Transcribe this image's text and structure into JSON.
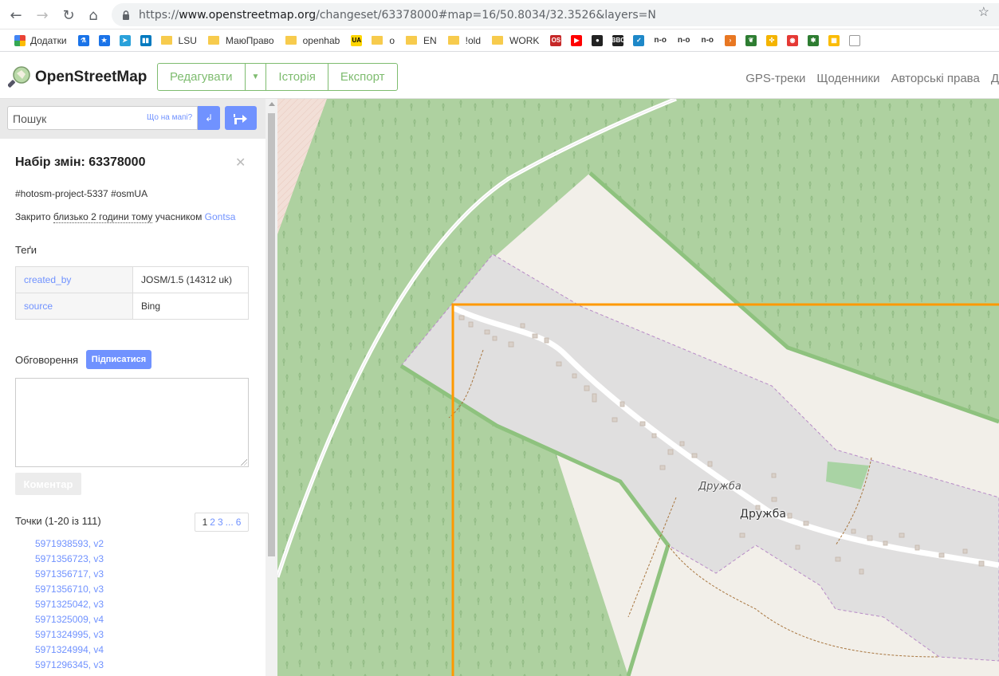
{
  "browser": {
    "url_scheme": "https://",
    "url_host": "www.openstreetmap.org",
    "url_path": "/changeset/63378000#map=16/50.8034/32.3526&layers=N",
    "bookmarks": [
      {
        "label": "Додатки",
        "kind": "apps"
      },
      {
        "label": "",
        "kind": "lab-icon"
      },
      {
        "label": "",
        "kind": "star-bookmark"
      },
      {
        "label": "",
        "kind": "telegram"
      },
      {
        "label": "",
        "kind": "trello"
      },
      {
        "label": "LSU",
        "kind": "folder"
      },
      {
        "label": "МаюПраво",
        "kind": "folder"
      },
      {
        "label": "openhab",
        "kind": "folder"
      },
      {
        "label": "UA",
        "kind": "ua"
      },
      {
        "label": "o",
        "kind": "folder"
      },
      {
        "label": "EN",
        "kind": "folder"
      },
      {
        "label": "!old",
        "kind": "folder"
      },
      {
        "label": "WORK",
        "kind": "folder"
      },
      {
        "label": "os",
        "kind": "os"
      },
      {
        "label": "",
        "kind": "youtube"
      },
      {
        "label": "",
        "kind": "record"
      },
      {
        "label": "BBC",
        "kind": "bbc"
      },
      {
        "label": "",
        "kind": "check"
      },
      {
        "label": "n-o",
        "kind": "text"
      },
      {
        "label": "n-o",
        "kind": "text"
      },
      {
        "label": "n-o",
        "kind": "text"
      },
      {
        "label": "",
        "kind": "arrow"
      },
      {
        "label": "",
        "kind": "leaf"
      },
      {
        "label": "",
        "kind": "pinwheel"
      },
      {
        "label": "",
        "kind": "eye"
      },
      {
        "label": "",
        "kind": "bug"
      },
      {
        "label": "",
        "kind": "grid"
      },
      {
        "label": "",
        "kind": "page"
      }
    ]
  },
  "header": {
    "logo_text": "OpenStreetMap",
    "tabs": {
      "edit": "Редагувати",
      "history": "Історія",
      "export": "Експорт"
    },
    "nav": {
      "gps": "GPS-треки",
      "diaries": "Щоденники",
      "copyright": "Авторські права",
      "more": "Д"
    }
  },
  "search": {
    "placeholder": "Пошук",
    "hint": "Що на мапі?",
    "go": "↲"
  },
  "changeset": {
    "title": "Набір змін: 63378000",
    "comment": "#hotosm-project-5337 #osmUA",
    "closed_prefix": "Закрито ",
    "closed_time": "близько 2 години тому",
    "closed_by": " учасником ",
    "user": "Gontsa",
    "tags_label": "Теґи",
    "tags": [
      {
        "key": "created_by",
        "value": "JOSM/1.5 (14312 uk)"
      },
      {
        "key": "source",
        "value": "Bing"
      }
    ],
    "discussion_label": "Обговорення",
    "subscribe": "Підписатися",
    "comment_button": "Коментар",
    "nodes_label": "Точки (1-20 із 111)",
    "pager": {
      "p1": "1",
      "p2": "2",
      "p3": "3",
      "ellipsis": "...",
      "last": "6"
    },
    "nodes": [
      "5971938593, v2",
      "5971356723, v3",
      "5971356717, v3",
      "5971356710, v3",
      "5971325042, v3",
      "5971325009, v4",
      "5971324995, v3",
      "5971324994, v4",
      "5971296345, v3"
    ]
  },
  "map": {
    "labels": {
      "village": "Дружба",
      "village_italic": "Дружба"
    },
    "colors": {
      "forest": "#aed1a0",
      "farmland": "#eef0d5",
      "residential": "#e0dfdf",
      "bbox": "#ff9900"
    }
  }
}
